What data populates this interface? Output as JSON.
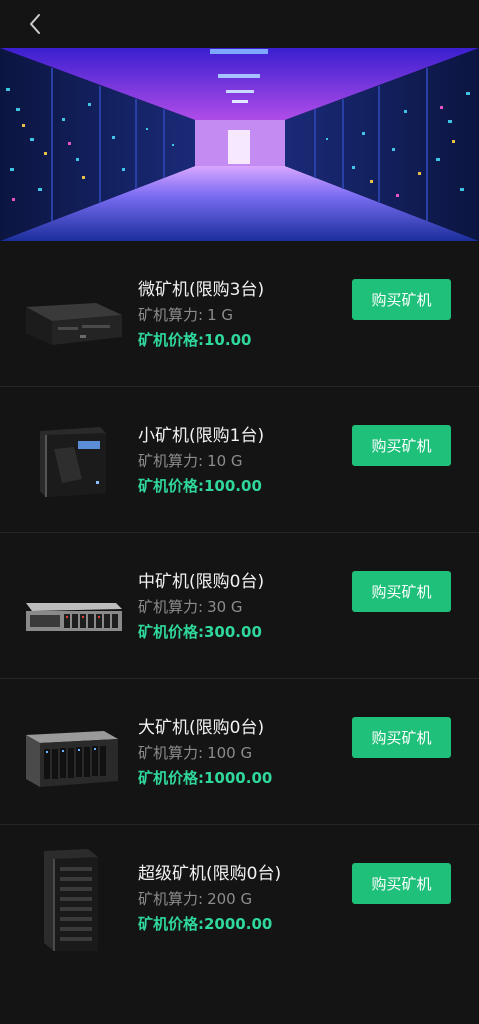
{
  "header": {
    "back_icon": "chevron-left-icon"
  },
  "miners": [
    {
      "name": "微矿机(限购3台)",
      "power_label": "矿机算力:",
      "power_value": "1 G",
      "price_label": "矿机价格:",
      "price_value": "10.00",
      "button": "购买矿机"
    },
    {
      "name": "小矿机(限购1台)",
      "power_label": "矿机算力:",
      "power_value": "10 G",
      "price_label": "矿机价格:",
      "price_value": "100.00",
      "button": "购买矿机"
    },
    {
      "name": "中矿机(限购0台)",
      "power_label": "矿机算力:",
      "power_value": "30 G",
      "price_label": "矿机价格:",
      "price_value": "300.00",
      "button": "购买矿机"
    },
    {
      "name": "大矿机(限购0台)",
      "power_label": "矿机算力:",
      "power_value": "100 G",
      "price_label": "矿机价格:",
      "price_value": "1000.00",
      "button": "购买矿机"
    },
    {
      "name": "超级矿机(限购0台)",
      "power_label": "矿机算力:",
      "power_value": "200 G",
      "price_label": "矿机价格:",
      "price_value": "2000.00",
      "button": "购买矿机"
    }
  ],
  "colors": {
    "accent": "#1ec07a",
    "price": "#2fd79b",
    "background": "#141414"
  }
}
